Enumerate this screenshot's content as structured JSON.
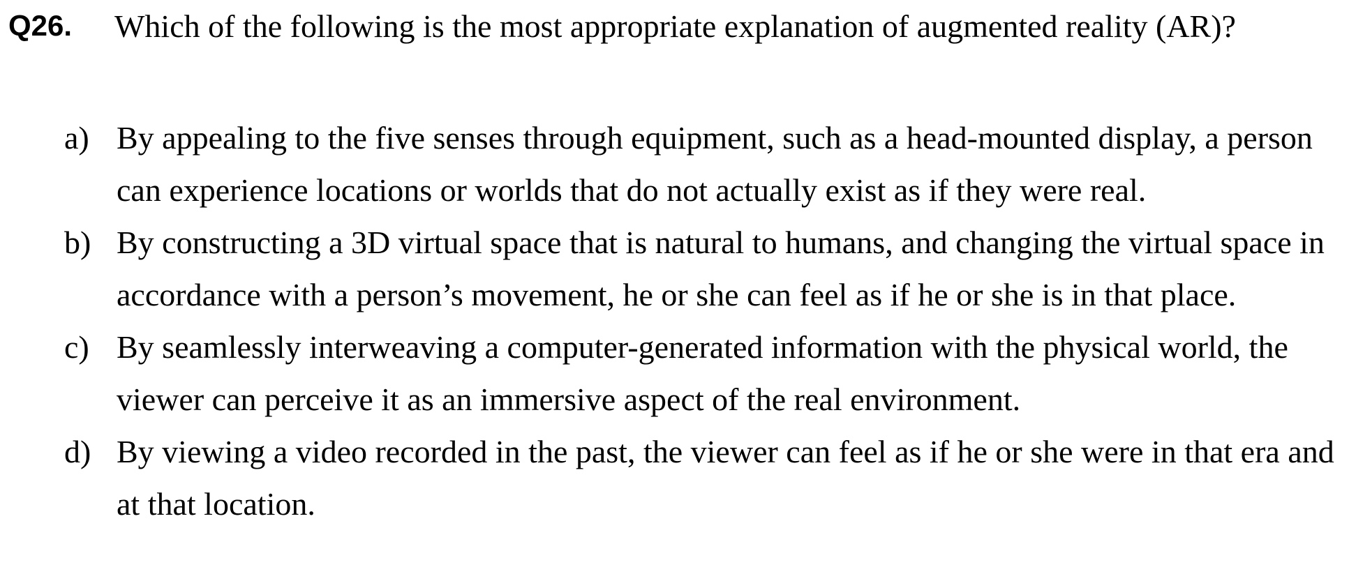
{
  "question": {
    "number": "Q26.",
    "stem": "Which of the following is the most appropriate explanation of augmented reality (AR)?",
    "options": [
      {
        "letter": "a)",
        "text": "By appealing to the five senses through equipment, such as a head-mounted display, a person can experience locations or worlds that do not actually exist as if they were real."
      },
      {
        "letter": "b)",
        "text": "By constructing a 3D virtual space that is natural to humans, and changing the virtual space in accordance with a person’s movement, he or she can feel as if he or she is in that place."
      },
      {
        "letter": "c)",
        "text": "By seamlessly interweaving a computer-generated information with the physical world, the viewer can perceive it as an immersive aspect of the real environment."
      },
      {
        "letter": "d)",
        "text": "By viewing a video recorded in the past, the viewer can feel as if he or she were in that era and at that location."
      }
    ]
  }
}
